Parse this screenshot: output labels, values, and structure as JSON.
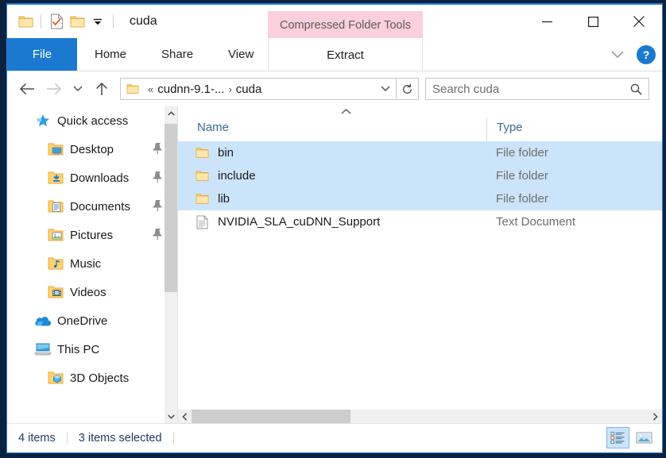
{
  "window": {
    "title": "cuda",
    "contextual_tab": "Compressed Folder Tools",
    "quick_access_icons": [
      "folder-icon",
      "properties-check-icon",
      "new-folder-icon",
      "customize-qat-chevron-icon"
    ],
    "controls": {
      "minimize": "minimize-icon",
      "maximize": "maximize-icon",
      "close": "close-icon"
    }
  },
  "ribbon": {
    "tabs": [
      {
        "label": "File",
        "active": true
      },
      {
        "label": "Home",
        "active": false
      },
      {
        "label": "Share",
        "active": false
      },
      {
        "label": "View",
        "active": false
      }
    ],
    "contextual_tab_label": "Extract",
    "collapse_icon": "chevron-down-icon",
    "help_label": "?"
  },
  "address": {
    "back_icon": "arrow-left-icon",
    "forward_icon": "arrow-right-icon",
    "recent_icon": "chevron-down-icon",
    "up_icon": "arrow-up-icon",
    "overflow_chevrons": "«",
    "crumbs": [
      "cudnn-9.1-...",
      "cuda"
    ],
    "crumb_separator": "›",
    "dropdown_icon": "chevron-down-icon",
    "refresh_icon": "refresh-icon"
  },
  "search": {
    "placeholder": "Search cuda",
    "value": "",
    "icon": "search-icon"
  },
  "sidebar": {
    "items": [
      {
        "label": "Quick access",
        "icon": "quick-access-star-icon",
        "level": 0,
        "pinned": false
      },
      {
        "label": "Desktop",
        "icon": "desktop-folder-icon",
        "level": 1,
        "pinned": true
      },
      {
        "label": "Downloads",
        "icon": "downloads-folder-icon",
        "level": 1,
        "pinned": true
      },
      {
        "label": "Documents",
        "icon": "documents-folder-icon",
        "level": 1,
        "pinned": true
      },
      {
        "label": "Pictures",
        "icon": "pictures-folder-icon",
        "level": 1,
        "pinned": true
      },
      {
        "label": "Music",
        "icon": "music-folder-icon",
        "level": 1,
        "pinned": false
      },
      {
        "label": "Videos",
        "icon": "videos-folder-icon",
        "level": 1,
        "pinned": false
      },
      {
        "label": "OneDrive",
        "icon": "onedrive-cloud-icon",
        "level": 0,
        "pinned": false
      },
      {
        "label": "This PC",
        "icon": "this-pc-monitor-icon",
        "level": 0,
        "pinned": false
      },
      {
        "label": "3D Objects",
        "icon": "3d-objects-folder-icon",
        "level": 1,
        "pinned": false
      }
    ],
    "scroll_up_icon": "chevron-up-icon",
    "scroll_down_icon": "chevron-down-icon"
  },
  "filelist": {
    "columns": [
      "Name",
      "Type"
    ],
    "sort_indicator": "ascending-caret-icon",
    "rows": [
      {
        "name": "bin",
        "type": "File folder",
        "icon": "folder-icon",
        "selected": true
      },
      {
        "name": "include",
        "type": "File folder",
        "icon": "folder-icon",
        "selected": true
      },
      {
        "name": "lib",
        "type": "File folder",
        "icon": "folder-icon",
        "selected": true
      },
      {
        "name": "NVIDIA_SLA_cuDNN_Support",
        "type": "Text Document",
        "icon": "text-document-icon",
        "selected": false
      }
    ],
    "hscroll_left_icon": "chevron-left-icon",
    "hscroll_right_icon": "chevron-right-icon"
  },
  "statusbar": {
    "item_count": "4 items",
    "selection_count": "3 items selected",
    "view_details_icon": "details-view-icon",
    "view_large_icons_icon": "large-icons-view-icon"
  },
  "colors": {
    "accent": "#1b7ad0",
    "selection": "#cce4fa",
    "contextual_tab": "#fbcfdc",
    "folder_yellow": "#ffd271",
    "desktop_background": "#0a2240"
  }
}
